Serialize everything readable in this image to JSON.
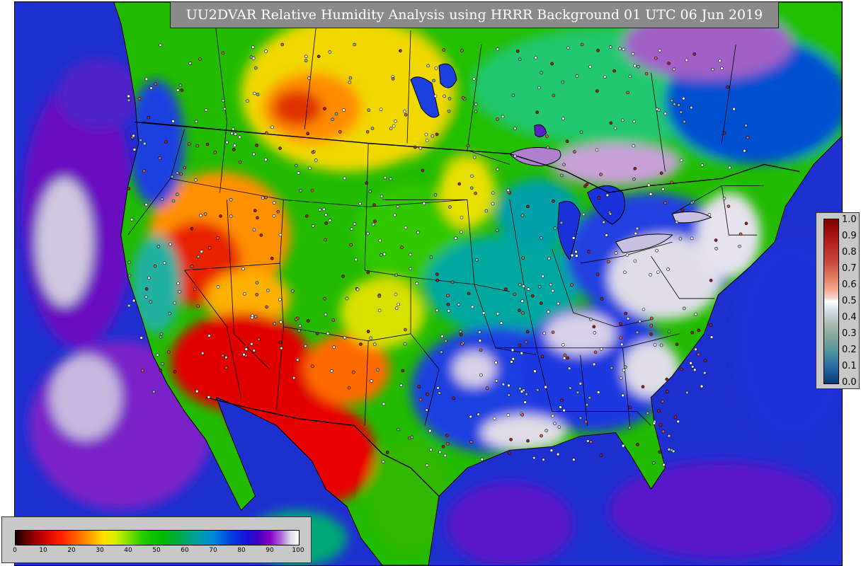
{
  "title": "UU2DVAR Relative Humidity Analysis using HRRR Background 01 UTC 06 Jun 2019",
  "rh_colorbar": {
    "ticks": [
      "0",
      "10",
      "20",
      "30",
      "40",
      "50",
      "60",
      "70",
      "80",
      "90",
      "100"
    ],
    "range": [
      0,
      100
    ],
    "colors": [
      "#140000",
      "#cc0000",
      "#ff6a00",
      "#ffe000",
      "#7fe000",
      "#00b800",
      "#00a0a0",
      "#0040e0",
      "#4a00c0",
      "#b070d8",
      "#ffffff"
    ]
  },
  "increment_colorbar": {
    "ticks": [
      "1.0",
      "0.9",
      "0.8",
      "0.7",
      "0.6",
      "0.5",
      "0.4",
      "0.3",
      "0.2",
      "0.1",
      "0.0"
    ],
    "range": [
      0.0,
      1.0
    ]
  },
  "map": {
    "projection": "Lambert conformal",
    "region": "CONUS with southern Canada and northern Mexico",
    "colors": {
      "ocean": "#1e2fd0",
      "deep_ocean": "#6a10c0",
      "dry_red": "#e00000",
      "orange": "#ff8c00",
      "yellow": "#f0e000",
      "green": "#22bb00",
      "teal": "#00a0a0",
      "humid_blue": "#1a40e0",
      "saturated": "#e0dde8",
      "boundary": "#000000"
    }
  }
}
